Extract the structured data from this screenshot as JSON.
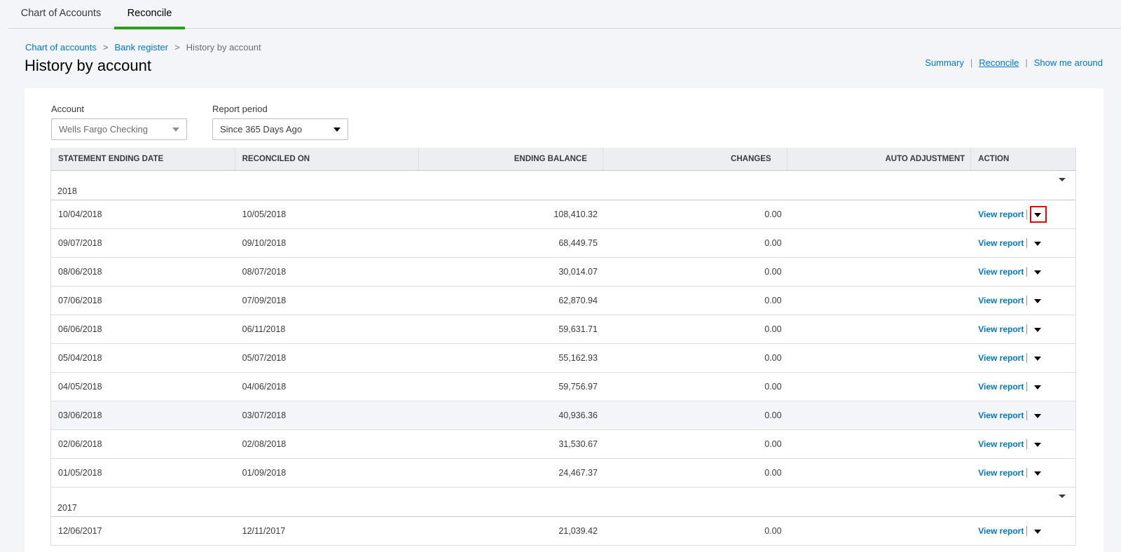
{
  "tabs": [
    {
      "label": "Chart of Accounts"
    },
    {
      "label": "Reconcile"
    }
  ],
  "breadcrumb": {
    "items": [
      "Chart of accounts",
      "Bank register",
      "History by account"
    ],
    "separator": ">"
  },
  "page_title": "History by account",
  "top_links": {
    "summary": "Summary",
    "reconcile": "Reconcile",
    "show_me_around": "Show me around",
    "divider": "|"
  },
  "filters": {
    "account_label": "Account",
    "account_value": "Wells Fargo Checking",
    "period_label": "Report period",
    "period_value": "Since 365 Days Ago"
  },
  "table": {
    "headers": [
      "STATEMENT ENDING DATE",
      "RECONCILED ON",
      "ENDING BALANCE",
      "CHANGES",
      "AUTO ADJUSTMENT",
      "ACTION"
    ],
    "action_label": "View report",
    "groups": [
      {
        "label": "2018",
        "rows": [
          {
            "statement": "10/04/2018",
            "reconciled": "10/05/2018",
            "balance": "108,410.32",
            "changes": "0.00",
            "auto": ""
          },
          {
            "statement": "09/07/2018",
            "reconciled": "09/10/2018",
            "balance": "68,449.75",
            "changes": "0.00",
            "auto": ""
          },
          {
            "statement": "08/06/2018",
            "reconciled": "08/07/2018",
            "balance": "30,014.07",
            "changes": "0.00",
            "auto": ""
          },
          {
            "statement": "07/06/2018",
            "reconciled": "07/09/2018",
            "balance": "62,870.94",
            "changes": "0.00",
            "auto": ""
          },
          {
            "statement": "06/06/2018",
            "reconciled": "06/11/2018",
            "balance": "59,631.71",
            "changes": "0.00",
            "auto": ""
          },
          {
            "statement": "05/04/2018",
            "reconciled": "05/07/2018",
            "balance": "55,162.93",
            "changes": "0.00",
            "auto": ""
          },
          {
            "statement": "04/05/2018",
            "reconciled": "04/06/2018",
            "balance": "59,756.97",
            "changes": "0.00",
            "auto": ""
          },
          {
            "statement": "03/06/2018",
            "reconciled": "03/07/2018",
            "balance": "40,936.36",
            "changes": "0.00",
            "auto": ""
          },
          {
            "statement": "02/06/2018",
            "reconciled": "02/08/2018",
            "balance": "31,530.67",
            "changes": "0.00",
            "auto": ""
          },
          {
            "statement": "01/05/2018",
            "reconciled": "01/09/2018",
            "balance": "24,467.37",
            "changes": "0.00",
            "auto": ""
          }
        ]
      },
      {
        "label": "2017",
        "rows": [
          {
            "statement": "12/06/2017",
            "reconciled": "12/11/2017",
            "balance": "21,039.42",
            "changes": "0.00",
            "auto": ""
          }
        ]
      }
    ]
  },
  "colors": {
    "accent_green": "#2ca01c",
    "link_blue": "#0077c5",
    "highlight_box": "#e00000"
  }
}
